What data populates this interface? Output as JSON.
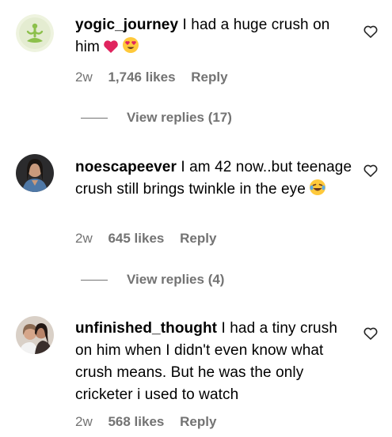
{
  "comments": [
    {
      "username": "yogic_journey",
      "text": "I had a huge crush on him",
      "emojis": [
        "red-heart",
        "heart-eyes-face"
      ],
      "age": "2w",
      "likes": "1,746 likes",
      "reply_label": "Reply",
      "view_replies": "View replies (17)",
      "avatar_icon": "meditation-pose-icon"
    },
    {
      "username": "noescapeever",
      "text": "I am 42 now..but teenage crush still brings twinkle in the eye",
      "emojis": [
        "laughing-tears-face"
      ],
      "age": "2w",
      "likes": "645 likes",
      "reply_label": "Reply",
      "view_replies": "View replies (4)",
      "avatar_icon": "user-photo"
    },
    {
      "username": "unfinished_thought",
      "text": "I had a tiny crush on him when I didn't even know what crush means. But he was the only cricketer i used to watch",
      "emojis": [],
      "age": "2w",
      "likes": "568 likes",
      "reply_label": "Reply",
      "avatar_icon": "user-photo"
    }
  ],
  "colors": {
    "text": "#000000",
    "muted": "#737373",
    "heart": "#e0245e",
    "emoji_yellow": "#ffc93b"
  }
}
